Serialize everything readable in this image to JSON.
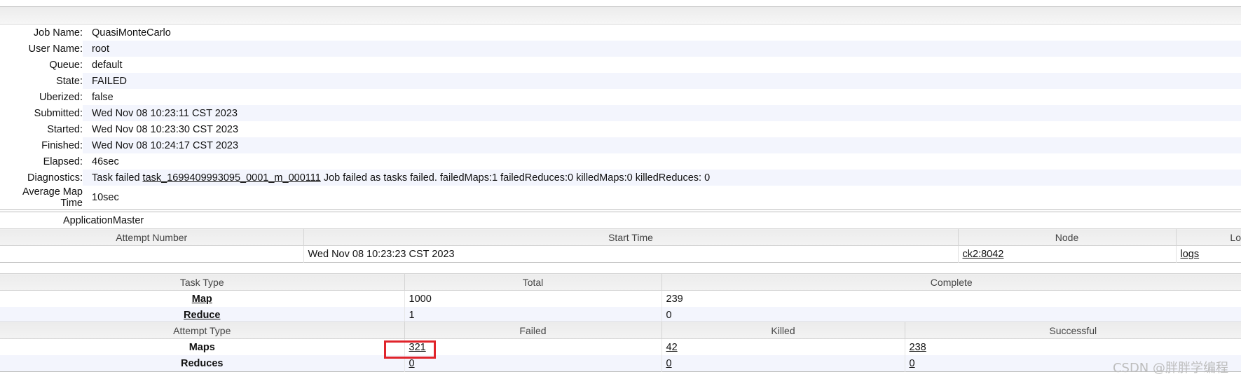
{
  "job_info": [
    {
      "label": "Job Name:",
      "value": "QuasiMonteCarlo"
    },
    {
      "label": "User Name:",
      "value": "root"
    },
    {
      "label": "Queue:",
      "value": "default"
    },
    {
      "label": "State:",
      "value": "FAILED"
    },
    {
      "label": "Uberized:",
      "value": "false"
    },
    {
      "label": "Submitted:",
      "value": "Wed Nov 08 10:23:11 CST 2023"
    },
    {
      "label": "Started:",
      "value": "Wed Nov 08 10:23:30 CST 2023"
    },
    {
      "label": "Finished:",
      "value": "Wed Nov 08 10:24:17 CST 2023"
    },
    {
      "label": "Elapsed:",
      "value": "46sec"
    },
    {
      "label": "Diagnostics:",
      "prefix": "Task failed ",
      "link": "task_1699409993095_0001_m_000111",
      "suffix": " Job failed as tasks failed. failedMaps:1 failedReduces:0 killedMaps:0 killedReduces: 0"
    },
    {
      "label": "Average Map Time",
      "value": "10sec"
    }
  ],
  "application_master": {
    "caption": "ApplicationMaster",
    "headers": [
      "Attempt Number",
      "Start Time",
      "Node",
      "Lo"
    ],
    "row": {
      "attempt": "",
      "start_time": "Wed Nov 08 10:23:23 CST 2023",
      "node": "ck2:8042",
      "logs": "logs"
    }
  },
  "task_table": {
    "headers": [
      "Task Type",
      "Total",
      "Complete"
    ],
    "rows": [
      {
        "type": "Map",
        "total": "1000",
        "complete": "239"
      },
      {
        "type": "Reduce",
        "total": "1",
        "complete": "0"
      }
    ]
  },
  "attempt_table": {
    "headers": [
      "Attempt Type",
      "Failed",
      "Killed",
      "Successful"
    ],
    "rows": [
      {
        "type": "Maps",
        "failed": "321",
        "killed": "42",
        "successful": "238"
      },
      {
        "type": "Reduces",
        "failed": "0",
        "killed": "0",
        "successful": "0"
      }
    ]
  },
  "watermark": "CSDN @胖胖学编程",
  "colors": {
    "highlight": "#e0242b",
    "alt_row": "#f3f5fd"
  }
}
